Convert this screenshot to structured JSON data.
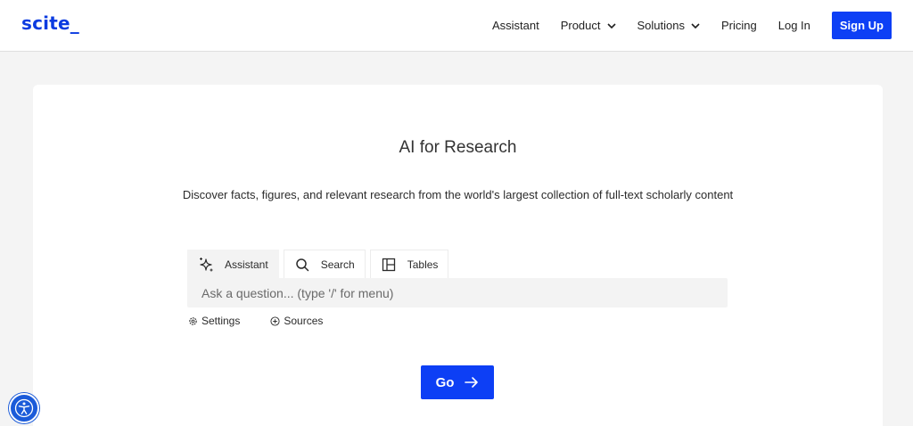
{
  "header": {
    "logo": "scite_",
    "nav": [
      {
        "label": "Assistant",
        "dropdown": false
      },
      {
        "label": "Product",
        "dropdown": true
      },
      {
        "label": "Solutions",
        "dropdown": true
      },
      {
        "label": "Pricing",
        "dropdown": false
      },
      {
        "label": "Log In",
        "dropdown": false
      }
    ],
    "signup_label": "Sign Up"
  },
  "hero": {
    "title": "AI for Research",
    "subtitle": "Discover facts, figures, and relevant research from the world's largest collection of full-text scholarly content"
  },
  "tabs": [
    {
      "label": "Assistant",
      "icon": "sparkles-icon",
      "active": true
    },
    {
      "label": "Search",
      "icon": "search-icon",
      "active": false
    },
    {
      "label": "Tables",
      "icon": "table-icon",
      "active": false
    }
  ],
  "query": {
    "placeholder": "Ask a question... (type '/' for menu)",
    "value": ""
  },
  "options": {
    "settings_label": "Settings",
    "sources_label": "Sources"
  },
  "go_label": "Go",
  "colors": {
    "brand": "#0d3ff5",
    "page_bg": "#f4f4f4",
    "input_bg": "#f3f3f3",
    "accessibility": "#1b5bd9"
  }
}
